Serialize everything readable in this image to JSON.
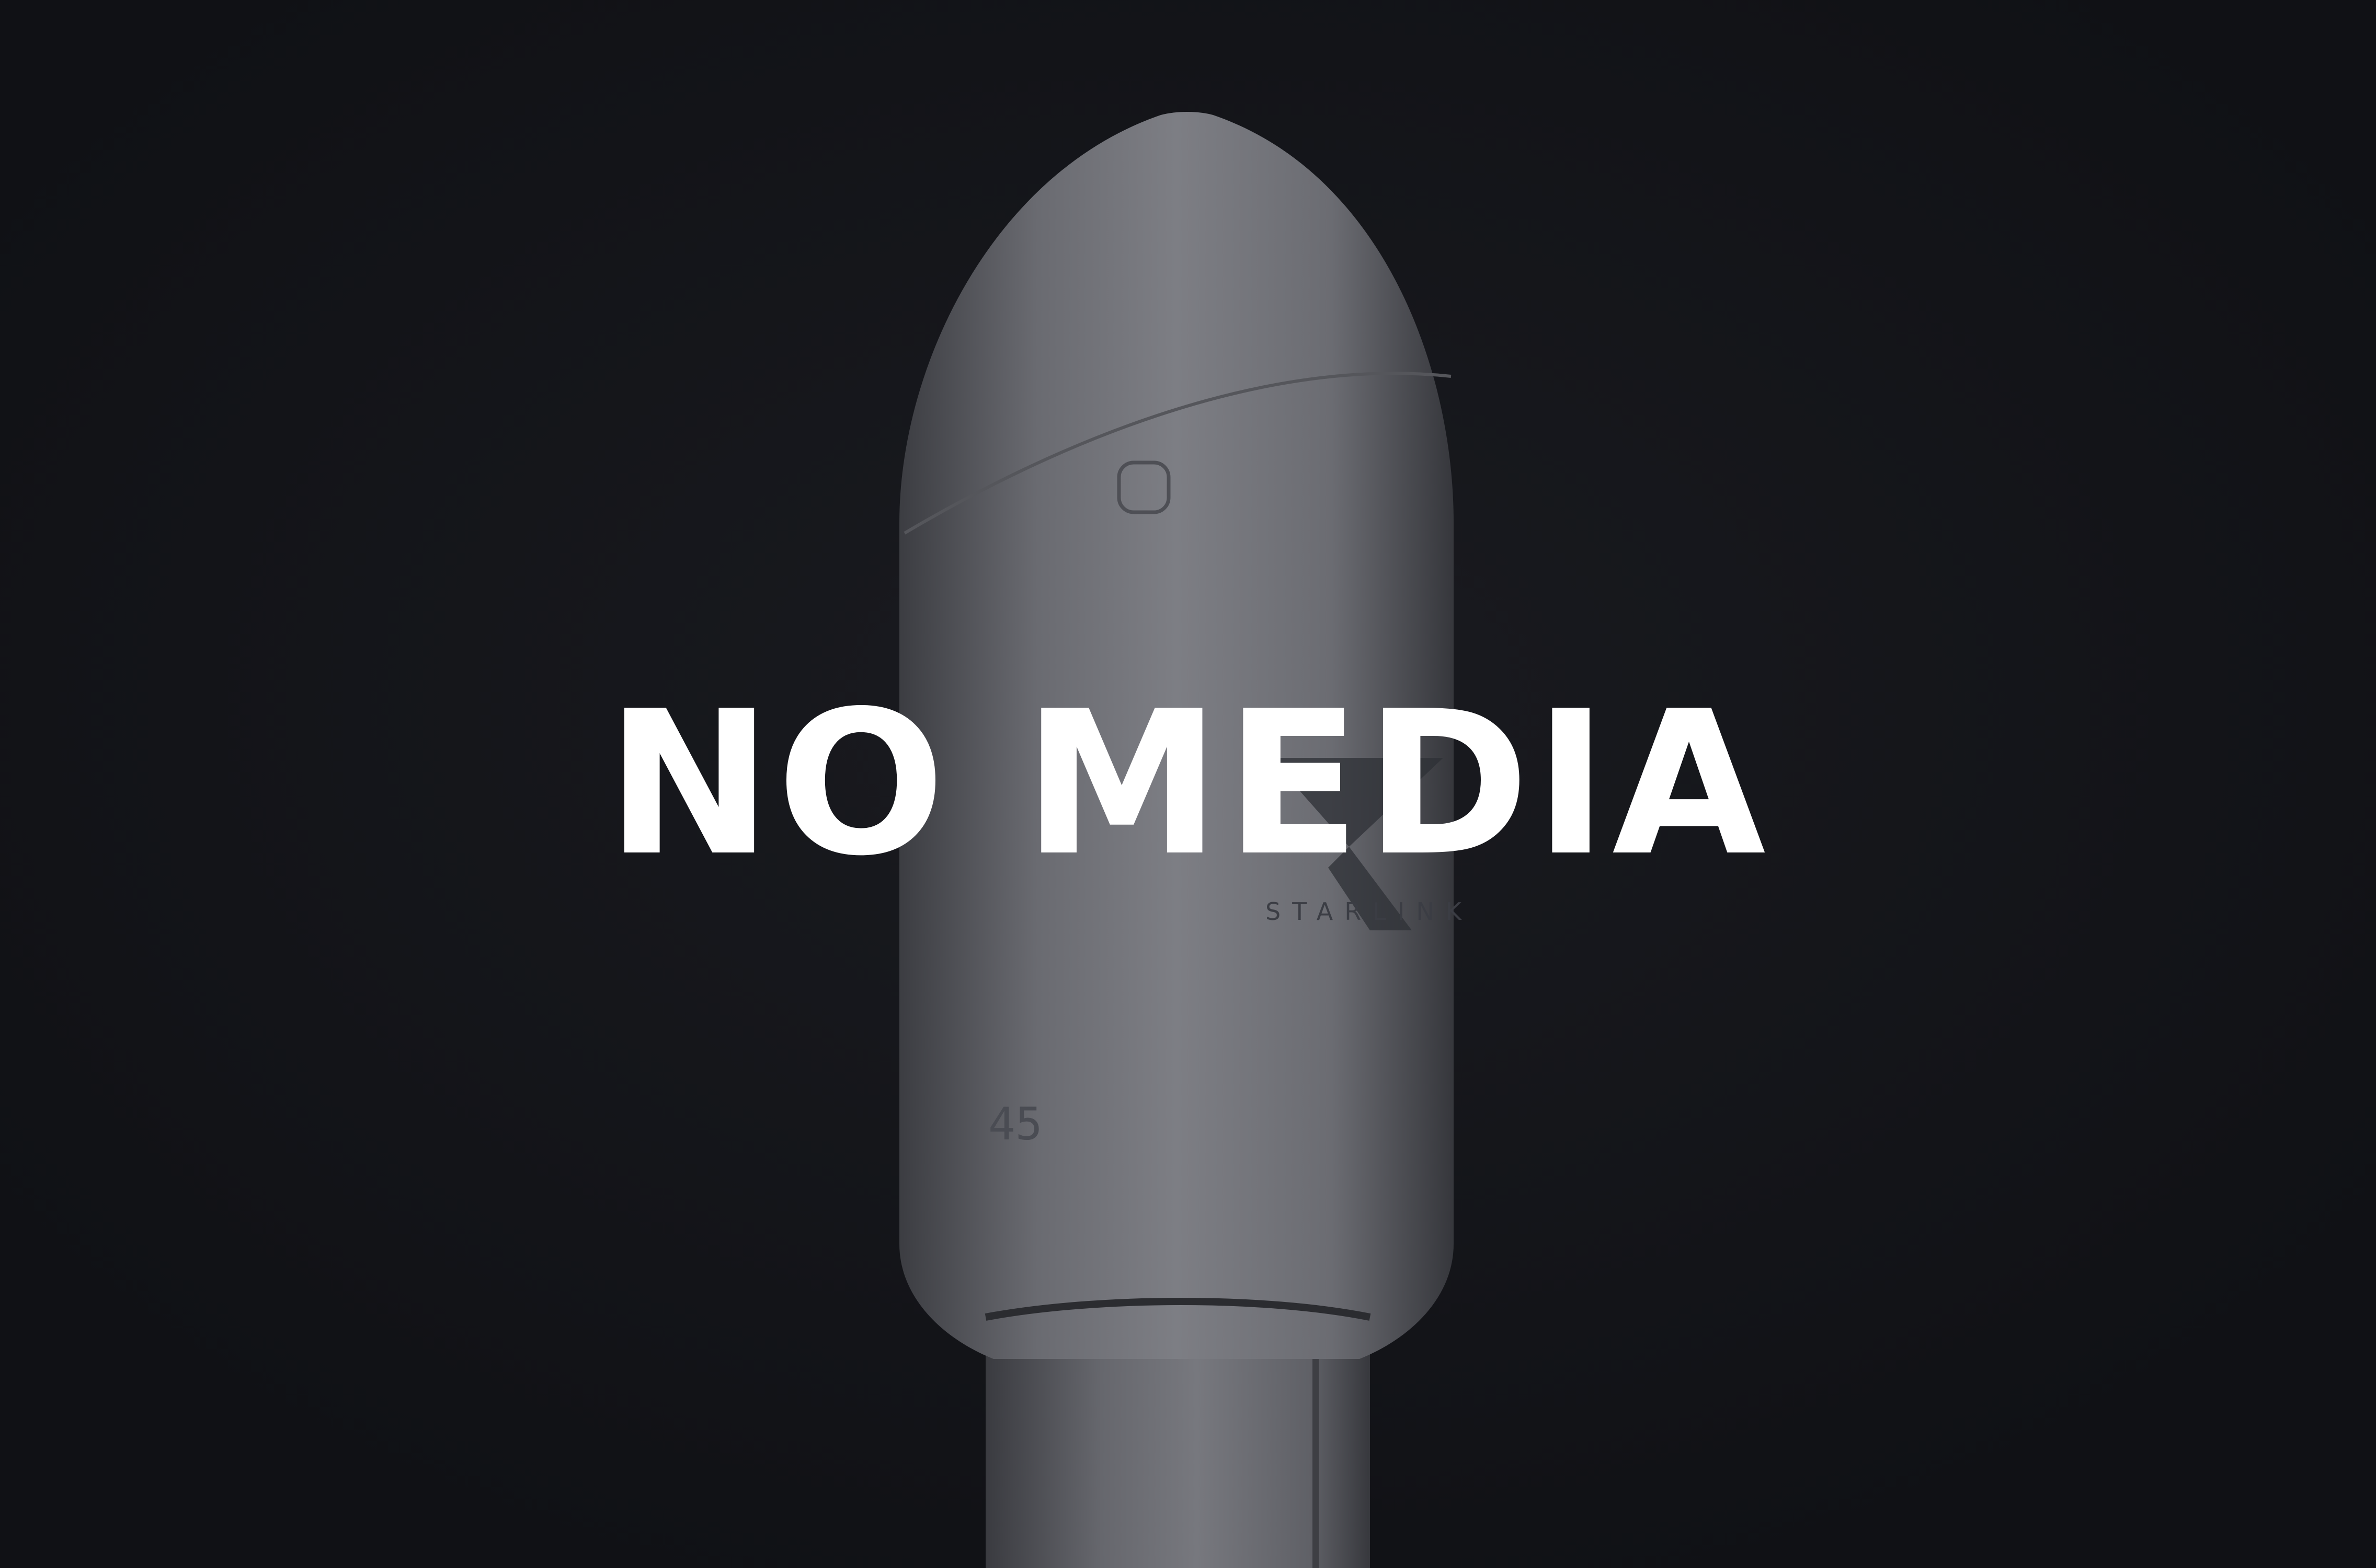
{
  "overlay": {
    "text": "NO MEDIA"
  },
  "vehicle": {
    "brand_text": "STARLINK",
    "fairing_number": "45",
    "logo_icon": "spacex-x-icon"
  },
  "colors": {
    "background": "#101115",
    "fairing": "#6e6f75",
    "fairing_shadow": "#3a3b40",
    "overlay_text": "#ffffff"
  }
}
